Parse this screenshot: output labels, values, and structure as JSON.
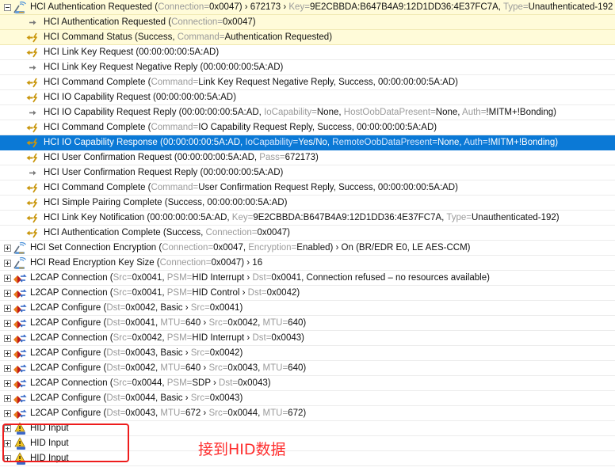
{
  "annotation": {
    "caption": "接到HID数据",
    "box_color": "#ee1c1c",
    "caption_color": "#ff2d2d"
  },
  "colors": {
    "selection": "#0b79d6",
    "highlight": "#fffbd9",
    "key_color": "#9a9a9a",
    "arrow_gold": "#c9960b"
  },
  "rows": [
    {
      "level": 0,
      "expander": "minus",
      "icon": "hci-antenna-icon",
      "hl": true,
      "sel": false,
      "parts": [
        [
          "HCI Authentication Requested (",
          0
        ],
        [
          "Connection=",
          1
        ],
        [
          "0x0047) › 672173 › ",
          0
        ],
        [
          "Key=",
          1
        ],
        [
          "9E2CBBDA:B647B4A9:12D1DD36:4E37FC7A, ",
          0
        ],
        [
          "Type=",
          1
        ],
        [
          "Unauthenticated-192",
          0
        ]
      ]
    },
    {
      "level": 1,
      "expander": "",
      "icon": "arrow-right-icon",
      "hl": true,
      "sel": false,
      "parts": [
        [
          "HCI Authentication Requested (",
          0
        ],
        [
          "Connection=",
          1
        ],
        [
          "0x0047)",
          0
        ]
      ]
    },
    {
      "level": 1,
      "expander": "",
      "icon": "event-arrow-left-icon",
      "hl": true,
      "sel": false,
      "parts": [
        [
          "HCI Command Status (Success, ",
          0
        ],
        [
          "Command=",
          1
        ],
        [
          "Authentication Requested)",
          0
        ]
      ]
    },
    {
      "level": 1,
      "expander": "",
      "icon": "event-arrow-left-icon",
      "hl": false,
      "sel": false,
      "parts": [
        [
          "HCI Link Key Request (00:00:00:00:5A:AD)",
          0
        ]
      ]
    },
    {
      "level": 1,
      "expander": "",
      "icon": "arrow-right-icon",
      "hl": false,
      "sel": false,
      "parts": [
        [
          "HCI Link Key Request Negative Reply (00:00:00:00:5A:AD)",
          0
        ]
      ]
    },
    {
      "level": 1,
      "expander": "",
      "icon": "event-arrow-left-icon",
      "hl": false,
      "sel": false,
      "parts": [
        [
          "HCI Command Complete (",
          0
        ],
        [
          "Command=",
          1
        ],
        [
          "Link Key Request Negative Reply, Success, 00:00:00:00:5A:AD)",
          0
        ]
      ]
    },
    {
      "level": 1,
      "expander": "",
      "icon": "event-arrow-left-icon",
      "hl": false,
      "sel": false,
      "parts": [
        [
          "HCI IO Capability Request (00:00:00:00:5A:AD)",
          0
        ]
      ]
    },
    {
      "level": 1,
      "expander": "",
      "icon": "arrow-right-icon",
      "hl": false,
      "sel": false,
      "parts": [
        [
          "HCI IO Capability Request Reply (00:00:00:00:5A:AD, ",
          0
        ],
        [
          "IoCapability=",
          1
        ],
        [
          "None, ",
          0
        ],
        [
          "HostOobDataPresent=",
          1
        ],
        [
          "None, ",
          0
        ],
        [
          "Auth=",
          1
        ],
        [
          "!MITM+!Bonding)",
          0
        ]
      ]
    },
    {
      "level": 1,
      "expander": "",
      "icon": "event-arrow-left-icon",
      "hl": false,
      "sel": false,
      "parts": [
        [
          "HCI Command Complete (",
          0
        ],
        [
          "Command=",
          1
        ],
        [
          "IO Capability Request Reply, Success, 00:00:00:00:5A:AD)",
          0
        ]
      ]
    },
    {
      "level": 1,
      "expander": "",
      "icon": "event-arrow-left-icon",
      "hl": false,
      "sel": true,
      "parts": [
        [
          "HCI IO Capability Response (00:00:00:00:5A:AD, ",
          0
        ],
        [
          "IoCapability=",
          1
        ],
        [
          "Yes/No, ",
          0
        ],
        [
          "RemoteOobDataPresent=",
          1
        ],
        [
          "None, ",
          0
        ],
        [
          "Auth=",
          1
        ],
        [
          "!MITM+!Bonding)",
          0
        ]
      ]
    },
    {
      "level": 1,
      "expander": "",
      "icon": "event-arrow-left-icon",
      "hl": false,
      "sel": false,
      "parts": [
        [
          "HCI User Confirmation Request (00:00:00:00:5A:AD, ",
          0
        ],
        [
          "Pass=",
          1
        ],
        [
          "672173)",
          0
        ]
      ]
    },
    {
      "level": 1,
      "expander": "",
      "icon": "arrow-right-icon",
      "hl": false,
      "sel": false,
      "parts": [
        [
          "HCI User Confirmation Request Reply (00:00:00:00:5A:AD)",
          0
        ]
      ]
    },
    {
      "level": 1,
      "expander": "",
      "icon": "event-arrow-left-icon",
      "hl": false,
      "sel": false,
      "parts": [
        [
          "HCI Command Complete (",
          0
        ],
        [
          "Command=",
          1
        ],
        [
          "User Confirmation Request Reply, Success, 00:00:00:00:5A:AD)",
          0
        ]
      ]
    },
    {
      "level": 1,
      "expander": "",
      "icon": "event-arrow-left-icon",
      "hl": false,
      "sel": false,
      "parts": [
        [
          "HCI Simple Pairing Complete (Success, 00:00:00:00:5A:AD)",
          0
        ]
      ]
    },
    {
      "level": 1,
      "expander": "",
      "icon": "event-arrow-left-icon",
      "hl": false,
      "sel": false,
      "parts": [
        [
          "HCI Link Key Notification (00:00:00:00:5A:AD, ",
          0
        ],
        [
          "Key=",
          1
        ],
        [
          "9E2CBBDA:B647B4A9:12D1DD36:4E37FC7A, ",
          0
        ],
        [
          "Type=",
          1
        ],
        [
          "Unauthenticated-192)",
          0
        ]
      ]
    },
    {
      "level": 1,
      "expander": "",
      "icon": "event-arrow-left-icon",
      "hl": false,
      "sel": false,
      "parts": [
        [
          "HCI Authentication Complete (Success, ",
          0
        ],
        [
          "Connection=",
          1
        ],
        [
          "0x0047)",
          0
        ]
      ]
    },
    {
      "level": 0,
      "expander": "plus",
      "icon": "hci-antenna-icon",
      "hl": false,
      "sel": false,
      "parts": [
        [
          "HCI Set Connection Encryption (",
          0
        ],
        [
          "Connection=",
          1
        ],
        [
          "0x0047, ",
          0
        ],
        [
          "Encryption=",
          1
        ],
        [
          "Enabled) › On (BR/EDR E0, LE AES-CCM)",
          0
        ]
      ]
    },
    {
      "level": 0,
      "expander": "plus",
      "icon": "hci-antenna-icon",
      "hl": false,
      "sel": false,
      "parts": [
        [
          "HCI Read Encryption Key Size (",
          0
        ],
        [
          "Connection=",
          1
        ],
        [
          "0x0047) › 16",
          0
        ]
      ]
    },
    {
      "level": 0,
      "expander": "plus",
      "icon": "l2cap-icon",
      "hl": false,
      "sel": false,
      "parts": [
        [
          "L2CAP Connection (",
          0
        ],
        [
          "Src=",
          1
        ],
        [
          "0x0041, ",
          0
        ],
        [
          "PSM=",
          1
        ],
        [
          "HID Interrupt › ",
          0
        ],
        [
          "Dst=",
          1
        ],
        [
          "0x0041, Connection refused – no resources available)",
          0
        ]
      ]
    },
    {
      "level": 0,
      "expander": "plus",
      "icon": "l2cap-icon",
      "hl": false,
      "sel": false,
      "parts": [
        [
          "L2CAP Connection (",
          0
        ],
        [
          "Src=",
          1
        ],
        [
          "0x0041, ",
          0
        ],
        [
          "PSM=",
          1
        ],
        [
          "HID Control › ",
          0
        ],
        [
          "Dst=",
          1
        ],
        [
          "0x0042)",
          0
        ]
      ]
    },
    {
      "level": 0,
      "expander": "plus",
      "icon": "l2cap-icon",
      "hl": false,
      "sel": false,
      "parts": [
        [
          "L2CAP Configure (",
          0
        ],
        [
          "Dst=",
          1
        ],
        [
          "0x0042, Basic › ",
          0
        ],
        [
          "Src=",
          1
        ],
        [
          "0x0041)",
          0
        ]
      ]
    },
    {
      "level": 0,
      "expander": "plus",
      "icon": "l2cap-icon",
      "hl": false,
      "sel": false,
      "parts": [
        [
          "L2CAP Configure (",
          0
        ],
        [
          "Dst=",
          1
        ],
        [
          "0x0041, ",
          0
        ],
        [
          "MTU=",
          1
        ],
        [
          "640 › ",
          0
        ],
        [
          "Src=",
          1
        ],
        [
          "0x0042, ",
          0
        ],
        [
          "MTU=",
          1
        ],
        [
          "640)",
          0
        ]
      ]
    },
    {
      "level": 0,
      "expander": "plus",
      "icon": "l2cap-icon",
      "hl": false,
      "sel": false,
      "parts": [
        [
          "L2CAP Connection (",
          0
        ],
        [
          "Src=",
          1
        ],
        [
          "0x0042, ",
          0
        ],
        [
          "PSM=",
          1
        ],
        [
          "HID Interrupt › ",
          0
        ],
        [
          "Dst=",
          1
        ],
        [
          "0x0043)",
          0
        ]
      ]
    },
    {
      "level": 0,
      "expander": "plus",
      "icon": "l2cap-icon",
      "hl": false,
      "sel": false,
      "parts": [
        [
          "L2CAP Configure (",
          0
        ],
        [
          "Dst=",
          1
        ],
        [
          "0x0043, Basic › ",
          0
        ],
        [
          "Src=",
          1
        ],
        [
          "0x0042)",
          0
        ]
      ]
    },
    {
      "level": 0,
      "expander": "plus",
      "icon": "l2cap-icon",
      "hl": false,
      "sel": false,
      "parts": [
        [
          "L2CAP Configure (",
          0
        ],
        [
          "Dst=",
          1
        ],
        [
          "0x0042, ",
          0
        ],
        [
          "MTU=",
          1
        ],
        [
          "640 › ",
          0
        ],
        [
          "Src=",
          1
        ],
        [
          "0x0043, ",
          0
        ],
        [
          "MTU=",
          1
        ],
        [
          "640)",
          0
        ]
      ]
    },
    {
      "level": 0,
      "expander": "plus",
      "icon": "l2cap-icon",
      "hl": false,
      "sel": false,
      "parts": [
        [
          "L2CAP Connection (",
          0
        ],
        [
          "Src=",
          1
        ],
        [
          "0x0044, ",
          0
        ],
        [
          "PSM=",
          1
        ],
        [
          "SDP › ",
          0
        ],
        [
          "Dst=",
          1
        ],
        [
          "0x0043)",
          0
        ]
      ]
    },
    {
      "level": 0,
      "expander": "plus",
      "icon": "l2cap-icon",
      "hl": false,
      "sel": false,
      "parts": [
        [
          "L2CAP Configure (",
          0
        ],
        [
          "Dst=",
          1
        ],
        [
          "0x0044, Basic › ",
          0
        ],
        [
          "Src=",
          1
        ],
        [
          "0x0043)",
          0
        ]
      ]
    },
    {
      "level": 0,
      "expander": "plus",
      "icon": "l2cap-icon",
      "hl": false,
      "sel": false,
      "parts": [
        [
          "L2CAP Configure (",
          0
        ],
        [
          "Dst=",
          1
        ],
        [
          "0x0043, ",
          0
        ],
        [
          "MTU=",
          1
        ],
        [
          "672 › ",
          0
        ],
        [
          "Src=",
          1
        ],
        [
          "0x0044, ",
          0
        ],
        [
          "MTU=",
          1
        ],
        [
          "672)",
          0
        ]
      ]
    },
    {
      "level": 0,
      "expander": "plus",
      "icon": "hid-warning-icon",
      "hl": false,
      "sel": false,
      "parts": [
        [
          "HID Input",
          0
        ]
      ]
    },
    {
      "level": 0,
      "expander": "plus",
      "icon": "hid-warning-icon",
      "hl": false,
      "sel": false,
      "parts": [
        [
          "HID Input",
          0
        ]
      ]
    },
    {
      "level": 0,
      "expander": "plus",
      "icon": "hid-warning-icon",
      "hl": false,
      "sel": false,
      "parts": [
        [
          "HID Input",
          0
        ]
      ]
    }
  ]
}
